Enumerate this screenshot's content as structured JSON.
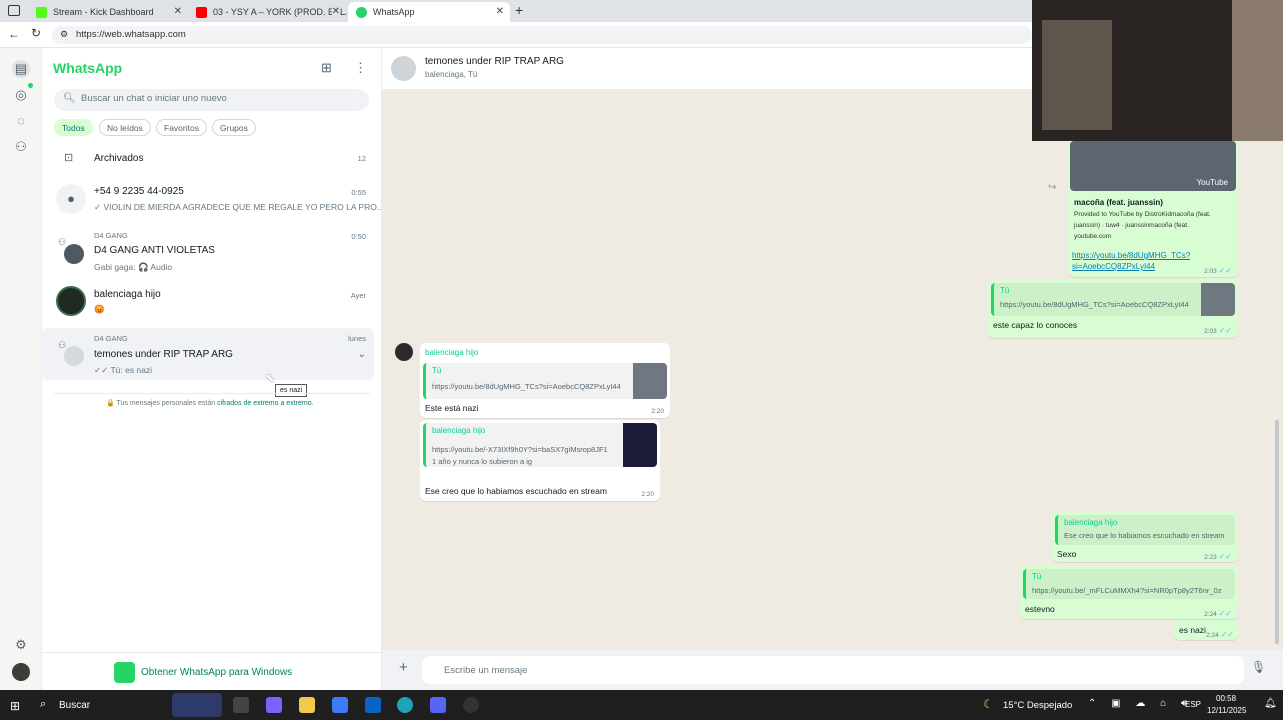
{
  "browser": {
    "tabs": [
      {
        "label": "Stream - Kick Dashboard",
        "favicon_color": "#53fc18"
      },
      {
        "label": "03 - YSY A – YORK (PROD. EVLAY",
        "favicon_color": "#ff0000"
      },
      {
        "label": "WhatsApp",
        "favicon_color": "#25d366"
      }
    ],
    "url": "https://web.whatsapp.com"
  },
  "sidebar": {
    "brand": "WhatsApp",
    "search_placeholder": "Buscar un chat o iniciar uno nuevo",
    "filters": [
      "Todos",
      "No leídos",
      "Favoritos",
      "Grupos"
    ],
    "archived": {
      "label": "Archivados",
      "count": "12"
    },
    "chats": [
      {
        "group": "",
        "title": "+54 9 2235 44-0925",
        "preview": "✓ VIOLIN DE MIERDA AGRADECE QUE ME REGALE YO PERO LA PRO...",
        "time": "0:55"
      },
      {
        "group": "D4 GANG",
        "title": "D4 GANG ANTI VIOLETAS",
        "preview": "Gabi gaga: 🎧 Audio",
        "time": "0:50"
      },
      {
        "group": "",
        "title": "balenciaga hijo",
        "preview": "😡",
        "time": "Ayer"
      },
      {
        "group": "D4 GANG",
        "title": "temones under RIP TRAP ARG",
        "preview": "✓✓ Tú: es nazi",
        "time": "lunes"
      }
    ],
    "tooltip": "es nazi",
    "encryption_prefix": "🔒 Tus mensajes personales están ",
    "encryption_link": "cifrados de extremo a extremo",
    "get_app": "Obtener WhatsApp para Windows"
  },
  "conversation": {
    "title": "temones under RIP TRAP ARG",
    "subtitle": "balenciaga, Tú",
    "composer_placeholder": "Escribe un mensaje",
    "messages": {
      "yt": {
        "title": "macoña (feat. juanssin)",
        "desc1": "Provided to YouTube by DistroKidmacoña (feat.",
        "desc2": "juanssin) · tuw4 · juanssinmacoña (feat.",
        "desc3": "youtube.com",
        "link1": "https://youtu.be/8dUgMHG_TCs?",
        "link2": "si=AoebcCQ8ZPxLyI44",
        "time": "2:03",
        "badge": "YouTube"
      },
      "m1": {
        "qname": "Tú",
        "qtext": "https://youtu.be/8dUgMHG_TCs?si=AoebcCQ8ZPxLyI44",
        "text": "este capaz lo conoces",
        "time": "2:03"
      },
      "m2": {
        "sender": "balenciaga hijo",
        "qname": "Tú",
        "qtext": "https://youtu.be/8dUgMHG_TCs?si=AoebcCQ8ZPxLyI44",
        "text": "Este está nazi",
        "time": "2:20"
      },
      "m3": {
        "qname": "balenciaga hijo",
        "qtext1": "https://youtu.be/-X73IXf9h0Y?si=baSX7giMsrop8JF1",
        "qtext2": "1 año y nunca lo subieron a ig",
        "text": "Ese creo que lo habiamos escuchado en stream",
        "time": "2:20"
      },
      "m4": {
        "qname": "balenciaga hijo",
        "qtext": "Ese creo que lo habiamos escuchado en stream",
        "text": "Sexo",
        "time": "2:23"
      },
      "m5": {
        "qname": "Tú",
        "qtext": "https://youtu.be/_mFLCuMMXh4?si=NR0pTp8y2T6nr_0z",
        "text": "estevno",
        "time": "2:24"
      },
      "m6": {
        "text": "es nazi",
        "time": "2:24"
      }
    }
  },
  "taskbar": {
    "search": "Buscar",
    "weather": "15°C  Despejado",
    "lang": "ESP",
    "time": "00:58",
    "date": "12/11/2025"
  }
}
